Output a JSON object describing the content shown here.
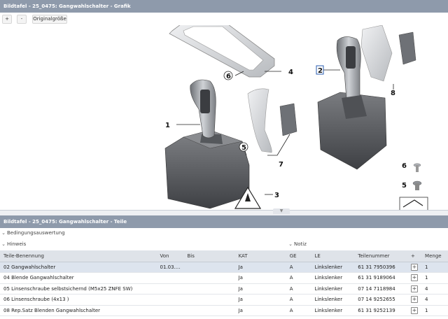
{
  "window": {
    "title_graphic": "Bildtafel - 25_0475: Gangwahlschalter - Grafik",
    "title_parts": "Bildtafel - 25_0475: Gangwahlschalter - Teile"
  },
  "toolbar": {
    "zoom_in": "+",
    "zoom_out": "-",
    "original_size": "Originalgröße"
  },
  "graphic": {
    "callouts": [
      "1",
      "2",
      "3",
      "4",
      "5",
      "6",
      "7",
      "8",
      "6",
      "5"
    ]
  },
  "sections": {
    "bedingung": "Bedingungsauswertung",
    "hinweis": "Hinweis",
    "notiz": "Notiz"
  },
  "table": {
    "headers": [
      "Teile-Benennung",
      "Von",
      "Bis",
      "KAT",
      "GE",
      "LE",
      "Teilenummer",
      "+",
      "Menge"
    ],
    "rows": [
      [
        "02 Gangwahlschalter",
        "01.03....",
        "",
        "Ja",
        "A",
        "Linkslenker",
        "61 31 7950396",
        "+",
        "1"
      ],
      [
        "04 Blende Gangwahlschalter",
        "",
        "",
        "Ja",
        "A",
        "Linkslenker",
        "61 31 9189064",
        "+",
        "1"
      ],
      [
        "05 Linsenschraube selbstsichernd (M5x25 ZNFE SW)",
        "",
        "",
        "Ja",
        "A",
        "Linkslenker",
        "07 14 7118984",
        "+",
        "4"
      ],
      [
        "06 Linsenschraube (4x13 )",
        "",
        "",
        "Ja",
        "A",
        "Linkslenker",
        "07 14 9252655",
        "+",
        "4"
      ],
      [
        "08 Rep.Satz Blenden Gangwahlschalter",
        "",
        "",
        "Ja",
        "A",
        "Linkslenker",
        "61 31 9252139",
        "+",
        "1"
      ]
    ]
  },
  "colors": {
    "titlebar": "#8e9aab",
    "header_row": "#dfe3e9",
    "selected_row": "#dde4ee"
  }
}
